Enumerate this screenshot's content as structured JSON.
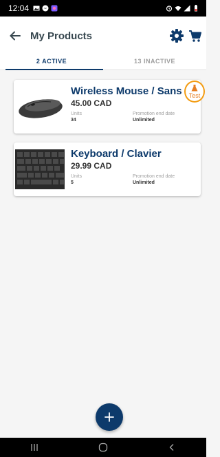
{
  "status_bar": {
    "time": "12:04",
    "left_icons": [
      "gallery-icon",
      "messenger-icon",
      "app-icon"
    ],
    "right_icons": [
      "alarm-icon",
      "wifi-icon",
      "signal-icon",
      "battery-icon"
    ]
  },
  "header": {
    "title": "My Products",
    "back_icon": "arrow-left-icon",
    "actions": [
      "settings-icon",
      "cart-icon"
    ]
  },
  "tabs": [
    {
      "label": "2  ACTIVE",
      "active": true
    },
    {
      "label": "13  INACTIVE",
      "active": false
    }
  ],
  "products": [
    {
      "name": "Wireless Mouse / Sans Fil",
      "price": "45.00 CAD",
      "units_label": "Units",
      "units": "34",
      "promo_label": "Promotion end date",
      "promo_value": "Unlimited",
      "image": "mouse-image"
    },
    {
      "name": "Keyboard / Clavier",
      "price": "29.99 CAD",
      "units_label": "Units",
      "units": "5",
      "promo_label": "Promotion end date",
      "promo_value": "Unlimited",
      "image": "keyboard-image"
    }
  ],
  "test_badge": {
    "label": "Test"
  },
  "fab": {
    "icon": "plus-icon"
  },
  "nav_bar": [
    "recents-icon",
    "home-icon",
    "back-icon"
  ],
  "colors": {
    "primary": "#0d3a6b",
    "accent": "#f39c12",
    "text": "#333333",
    "muted": "#9e9e9e",
    "background": "#f5f5f5"
  }
}
